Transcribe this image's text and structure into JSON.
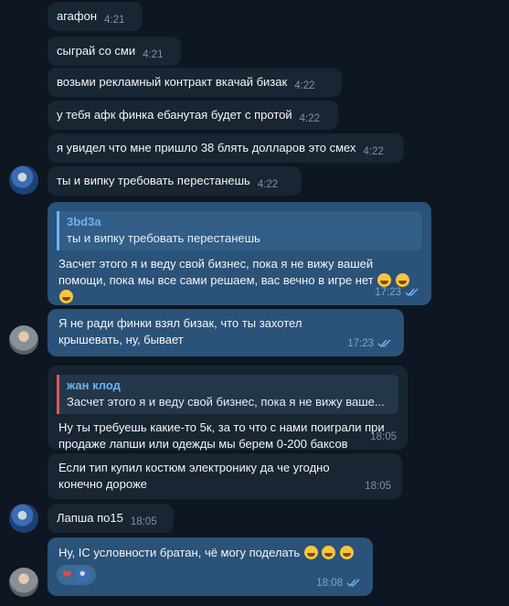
{
  "messages": [
    {
      "text": "агафон",
      "time": "4:21"
    },
    {
      "text": "сыграй со сми",
      "time": "4:21"
    },
    {
      "text": "возьми рекламный контракт вкачай бизак",
      "time": "4:22"
    },
    {
      "text": "у тебя афк финка ебанутая будет с протой",
      "time": "4:22"
    },
    {
      "text": "я увидел что мне пришло 38 блять долларов это смех",
      "time": "4:22"
    },
    {
      "text": "ты и випку требовать перестанешь",
      "time": "4:22"
    }
  ],
  "reply1": {
    "author": "3bd3a",
    "quote": "ты и випку требовать перестанешь",
    "text": "Засчет этого я и веду свой бизнес, пока я не вижу вашей помощи, пока мы все сами решаем, вас вечно в игре нет",
    "time": "17:23"
  },
  "msg8": {
    "text": "Я не ради финки взял бизак, что ты захотел крышевать, ну, бывает",
    "time": "17:23"
  },
  "reply2": {
    "author": "жан клод",
    "quote": "Засчет этого я и веду свой бизнес, пока я не вижу ваше...",
    "text": "Ну ты требуешь какие-то 5к, за то что с нами поиграли при продаже лапши или одежды мы берем 0-200 баксов",
    "time": "18:05"
  },
  "msg10": {
    "text": "Если тип купил костюм электронику да че угодно конечно дороже",
    "time": "18:05"
  },
  "msg11": {
    "text": "Лапша по15",
    "time": "18:05"
  },
  "msg12": {
    "text": "Ну, IC условности братан, чё могу поделать",
    "time": "18:08",
    "reaction": "❤"
  },
  "icons": {
    "read": "double-check-icon",
    "heart": "heart-icon",
    "emoji_laugh": "face-with-tears-of-joy",
    "emoji_smile": "smiling-face"
  },
  "colors": {
    "background": "#0e1621",
    "incoming": "#182533",
    "outgoing": "#2b5278",
    "accent": "#6ab3f3"
  }
}
